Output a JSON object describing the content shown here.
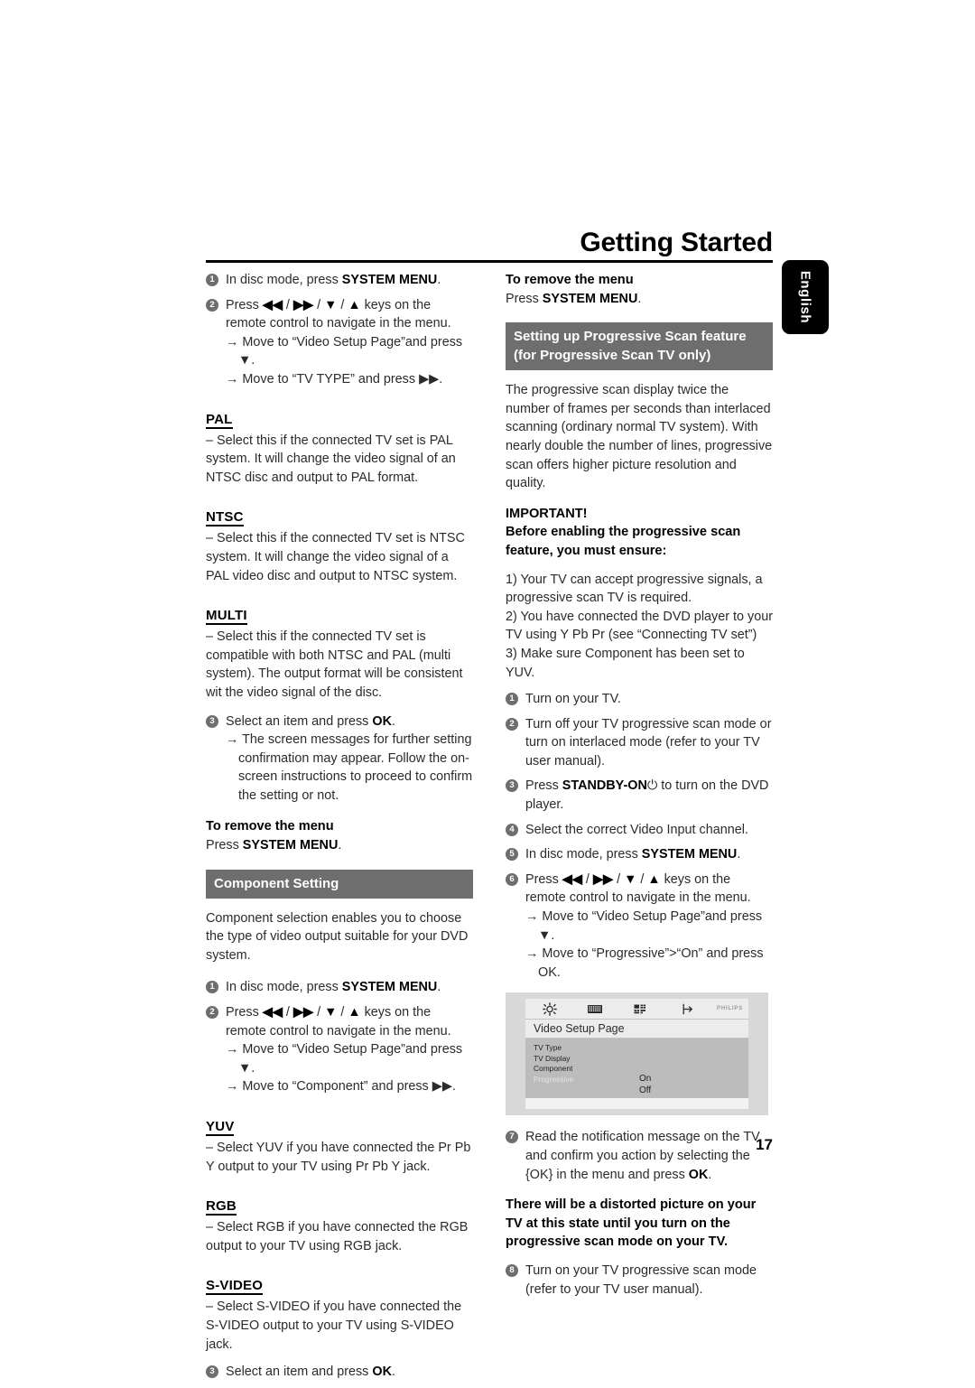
{
  "page": {
    "header_title": "Getting Started",
    "language_tab": "English",
    "page_number": "17"
  },
  "left_column": {
    "steps_tv_type": [
      {
        "num": "1",
        "text_parts": [
          {
            "t": "In disc mode, press ",
            "b": false
          },
          {
            "t": "SYSTEM MENU",
            "b": true
          },
          {
            "t": ".",
            "b": false
          }
        ]
      },
      {
        "num": "2",
        "text_parts": [
          {
            "t": "Press ",
            "b": false
          },
          {
            "t": "◀◀",
            "b": true
          },
          {
            "t": " / ",
            "b": false
          },
          {
            "t": "▶▶",
            "b": true
          },
          {
            "t": " / ",
            "b": false
          },
          {
            "t": "▼",
            "b": true
          },
          {
            "t": " / ",
            "b": false
          },
          {
            "t": "▲",
            "b": true
          },
          {
            "t": " keys on the remote control to navigate in the menu.",
            "b": false
          }
        ],
        "arrows": [
          "→ Move to “Video Setup Page”and press ▼.",
          "→ Move to “TV TYPE” and press ▶▶."
        ]
      }
    ],
    "terms": [
      {
        "term": "PAL",
        "definition": "–   Select this if the connected TV set is PAL system. It will change the video signal of an NTSC disc and output to PAL format."
      },
      {
        "term": "NTSC",
        "definition": "–   Select this if the connected TV set is NTSC system. It will change the video signal of a PAL video disc and output to NTSC system."
      },
      {
        "term": "MULTI",
        "definition": "–   Select this if the connected TV set is compatible with both NTSC and PAL (multi system). The output format will be consistent wit the video signal of the disc."
      }
    ],
    "step3": {
      "num": "3",
      "lead_plain": "Select an item and press ",
      "lead_bold": "OK",
      "lead_tail": ".",
      "arrow": "→ The screen messages for further setting confirmation may appear. Follow the on-screen instructions to proceed to confirm the setting or not."
    },
    "remove_menu": {
      "heading": "To remove the menu",
      "line_plain": "Press ",
      "line_bold": "SYSTEM MENU",
      "line_tail": "."
    },
    "component_bar": "Component Setting",
    "component_intro": "Component selection enables you to choose the type of video output suitable for your DVD system.",
    "steps_component": [
      {
        "num": "1",
        "text_parts": [
          {
            "t": "In disc mode, press ",
            "b": false
          },
          {
            "t": "SYSTEM MENU",
            "b": true
          },
          {
            "t": ".",
            "b": false
          }
        ]
      },
      {
        "num": "2",
        "text_parts": [
          {
            "t": "Press ",
            "b": false
          },
          {
            "t": "◀◀",
            "b": true
          },
          {
            "t": " / ",
            "b": false
          },
          {
            "t": "▶▶",
            "b": true
          },
          {
            "t": " / ",
            "b": false
          },
          {
            "t": "▼",
            "b": true
          },
          {
            "t": " / ",
            "b": false
          },
          {
            "t": "▲",
            "b": true
          },
          {
            "t": " keys on the remote control to navigate in the menu.",
            "b": false
          }
        ],
        "arrows": [
          "→ Move to “Video Setup Page”and press ▼.",
          "→ Move to “Component” and press ▶▶."
        ]
      }
    ],
    "terms2": [
      {
        "term": "YUV",
        "definition": "– Select YUV if you have connected the Pr Pb Y output to your TV using Pr Pb Y jack."
      },
      {
        "term": "RGB",
        "definition": "– Select RGB if you have connected the RGB output to your TV using RGB jack."
      },
      {
        "term": "S-VIDEO",
        "definition": "– Select S-VIDEO if you have connected the S-VIDEO output to your TV using S-VIDEO jack."
      }
    ],
    "final_step": {
      "num": "3",
      "lead_plain": "Select an item and press ",
      "lead_bold": "OK",
      "lead_tail": "."
    }
  },
  "right_column": {
    "remove_menu": {
      "heading": "To remove the menu",
      "line_plain": "Press ",
      "line_bold": "SYSTEM MENU",
      "line_tail": "."
    },
    "progressive_bar": "Setting up Progressive Scan feature (for Progressive Scan TV only)",
    "intro": "The progressive scan display twice the number of frames per seconds than interlaced scanning (ordinary normal TV system). With nearly double the number of lines, progressive scan offers higher picture resolution and quality.",
    "important_title": "IMPORTANT!",
    "important_sub": "Before enabling the progressive scan feature, you must ensure:",
    "important_list": [
      "1) Your TV can accept progressive signals, a progressive scan TV is required.",
      "2) You have connected the DVD player to your TV using Y Pb Pr (see “Connecting TV set”)",
      "3) Make sure Component has been set to YUV."
    ],
    "steps": [
      {
        "num": "1",
        "text_parts": [
          {
            "t": "Turn on your TV.",
            "b": false
          }
        ]
      },
      {
        "num": "2",
        "text_parts": [
          {
            "t": "Turn off your TV progressive scan mode or turn on interlaced mode (refer to your TV user manual).",
            "b": false
          }
        ]
      },
      {
        "num": "3",
        "text_parts": [
          {
            "t": "Press ",
            "b": false
          },
          {
            "t": "STANDBY-ON",
            "b": true
          },
          {
            "t": "⏻",
            "b": false
          },
          {
            "t": " to turn on the DVD player.",
            "b": false
          }
        ]
      },
      {
        "num": "4",
        "text_parts": [
          {
            "t": "Select the correct Video Input channel.",
            "b": false
          }
        ]
      },
      {
        "num": "5",
        "text_parts": [
          {
            "t": "In disc mode, press ",
            "b": false
          },
          {
            "t": "SYSTEM MENU",
            "b": true
          },
          {
            "t": ".",
            "b": false
          }
        ]
      },
      {
        "num": "6",
        "text_parts": [
          {
            "t": "Press ",
            "b": false
          },
          {
            "t": "◀◀",
            "b": true
          },
          {
            "t": " / ",
            "b": false
          },
          {
            "t": "▶▶",
            "b": true
          },
          {
            "t": " / ",
            "b": false
          },
          {
            "t": "▼",
            "b": true
          },
          {
            "t": " / ",
            "b": false
          },
          {
            "t": "▲",
            "b": true
          },
          {
            "t": " keys on the remote control to navigate in the menu.",
            "b": false
          }
        ],
        "arrows": [
          "→ Move to “Video Setup Page”and press ▼.",
          "→ Move to “Progressive”>“On” and press OK."
        ]
      }
    ],
    "osd": {
      "page_title": "Video Setup Page",
      "brand": "PHILIPS",
      "icons": [
        "general-setup-icon",
        "audio-setup-icon",
        "video-setup-icon",
        "exit-setup-icon"
      ],
      "menu_items": [
        "TV Type",
        "TV Display",
        "Component",
        "Progressive"
      ],
      "selected_item": "Progressive",
      "values": [
        "On",
        "Off"
      ]
    },
    "step7": {
      "num": "7",
      "lead_plain": "Read the notification message on the TV and confirm you action by selecting the {OK} in the menu and press ",
      "lead_bold": "OK",
      "lead_tail": "."
    },
    "warning": "There will be a distorted picture on your TV at this state until you turn on the progressive scan mode on your TV.",
    "step8": {
      "num": "8",
      "text": "Turn on your TV progressive scan mode (refer to your TV user manual)."
    }
  },
  "colors": {
    "gray_bar": "#6e6e6e",
    "bullet": "#6e6e6e",
    "osd_body": "#bcbcbc",
    "osd_chrome": "#ececec"
  }
}
